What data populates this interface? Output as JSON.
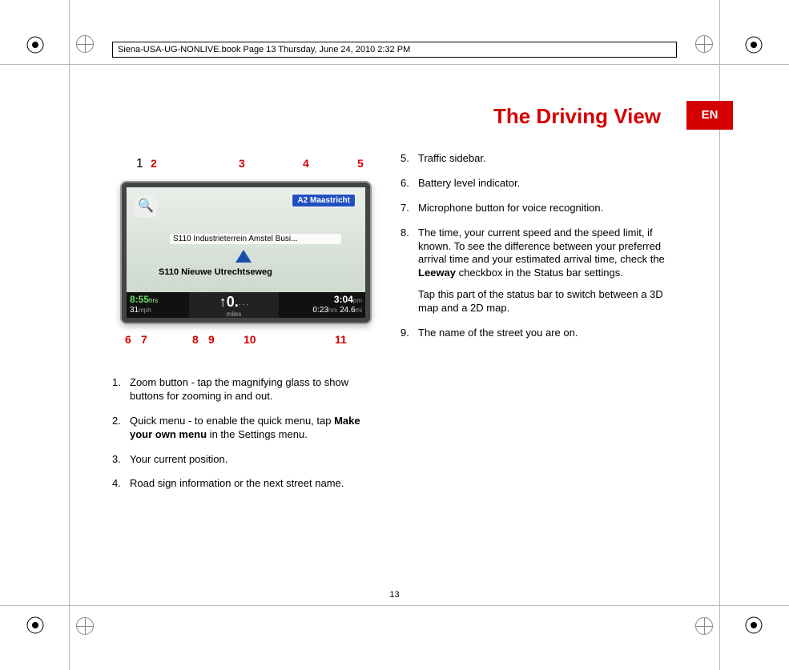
{
  "running_head": "Siena-USA-UG-NONLIVE.book  Page 13  Thursday, June 24, 2010  2:32 PM",
  "title": "The Driving View",
  "lang_tab": "EN",
  "page_number": "13",
  "callouts_top": {
    "c1": "1",
    "c2": "2",
    "c3": "3",
    "c4": "4",
    "c5": "5"
  },
  "callouts_bottom": {
    "c6": "6",
    "c7": "7",
    "c8": "8",
    "c9": "9",
    "c10": "10",
    "c11": "11"
  },
  "device": {
    "zoom_glyph": "🔍",
    "road_sign": "A2 Maastricht",
    "street1": "S110 Industrieterrein Amstel Busi...",
    "street2": "S110 Nieuwe Utrechtseweg",
    "sb_left_time": "8:55",
    "sb_left_time_unit": "hrs",
    "sb_left_speed": "31",
    "sb_left_speed_unit": "mph",
    "sb_mid_arrow": "↑",
    "sb_mid_dist": "0.",
    "sb_mid_dash": "- - -",
    "sb_mid_unit": "miles",
    "sb_right_eta": "3:04",
    "sb_right_eta_unit": "pm",
    "sb_right_remain": "0:23",
    "sb_right_remain_unit": "hrs",
    "sb_right_dist": "24.6",
    "sb_right_dist_unit": "mi"
  },
  "left_items": [
    {
      "n": "1.",
      "text": "Zoom button - tap the magnifying glass to show buttons for zooming in and out."
    },
    {
      "n": "2.",
      "prefix": "Quick menu - to enable the quick menu, tap ",
      "bold": "Make your own menu",
      "suffix": " in the Settings menu."
    },
    {
      "n": "3.",
      "text": "Your current position."
    },
    {
      "n": "4.",
      "text": "Road sign information or the next street name."
    }
  ],
  "right_items": [
    {
      "n": "5.",
      "text": "Traffic sidebar."
    },
    {
      "n": "6.",
      "text": "Battery level indicator."
    },
    {
      "n": "7.",
      "text": "Microphone button for voice recognition."
    },
    {
      "n": "8.",
      "prefix": "The time, your current speed and the speed limit, if known. To see the difference between your preferred arrival time and your estimated arrival time, check the ",
      "bold": "Leeway",
      "suffix": " checkbox in the Status bar settings.",
      "post": "Tap this part of the status bar to switch between a 3D map and a 2D map."
    },
    {
      "n": "9.",
      "text": "The name of the street you are on."
    }
  ]
}
